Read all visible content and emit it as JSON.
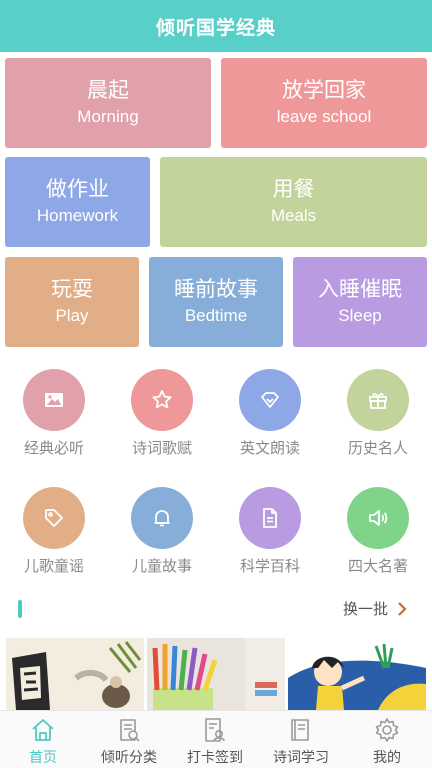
{
  "header": {
    "title": "倾听国学经典"
  },
  "scene_tiles": [
    {
      "cn": "晨起",
      "en": "Morning",
      "color": "#e0a1aa"
    },
    {
      "cn": "放学回家",
      "en": "leave school",
      "color": "#ef9899"
    },
    {
      "cn": "做作业",
      "en": "Homework",
      "color": "#8ea7e7"
    },
    {
      "cn": "用餐",
      "en": "Meals",
      "color": "#c2d39c"
    },
    {
      "cn": "玩耍",
      "en": "Play",
      "color": "#e1ae88"
    },
    {
      "cn": "睡前故事",
      "en": "Bedtime",
      "color": "#87aed8"
    },
    {
      "cn": "入睡催眠",
      "en": "Sleep",
      "color": "#b89be0"
    }
  ],
  "categories": [
    {
      "label": "经典必听",
      "icon": "image-icon",
      "color": "#e0a1aa"
    },
    {
      "label": "诗词歌赋",
      "icon": "star-icon",
      "color": "#ef9899"
    },
    {
      "label": "英文朗读",
      "icon": "diamond-icon",
      "color": "#8ea7e7"
    },
    {
      "label": "历史名人",
      "icon": "gift-icon",
      "color": "#c2d39c"
    },
    {
      "label": "儿歌童谣",
      "icon": "tag-icon",
      "color": "#e1ae88"
    },
    {
      "label": "儿童故事",
      "icon": "bell-icon",
      "color": "#87aed8"
    },
    {
      "label": "科学百科",
      "icon": "document-icon",
      "color": "#b89be0"
    },
    {
      "label": "四大名著",
      "icon": "speaker-icon",
      "color": "#7fd48a"
    }
  ],
  "section": {
    "refresh_label": "换一批",
    "refresh_icon": "chevron-right-icon"
  },
  "thumbnails": [
    {
      "name": "calligraphy-thumbnail"
    },
    {
      "name": "pencils-thumbnail"
    },
    {
      "name": "cartoon-kid-thumbnail"
    }
  ],
  "tabbar": {
    "active_color": "#4fc9c3",
    "items": [
      {
        "label": "首页",
        "icon": "home-icon",
        "active": true
      },
      {
        "label": "倾听分类",
        "icon": "category-icon",
        "active": false
      },
      {
        "label": "打卡签到",
        "icon": "checkin-icon",
        "active": false
      },
      {
        "label": "诗词学习",
        "icon": "book-icon",
        "active": false
      },
      {
        "label": "我的",
        "icon": "gear-icon",
        "active": false
      }
    ]
  }
}
